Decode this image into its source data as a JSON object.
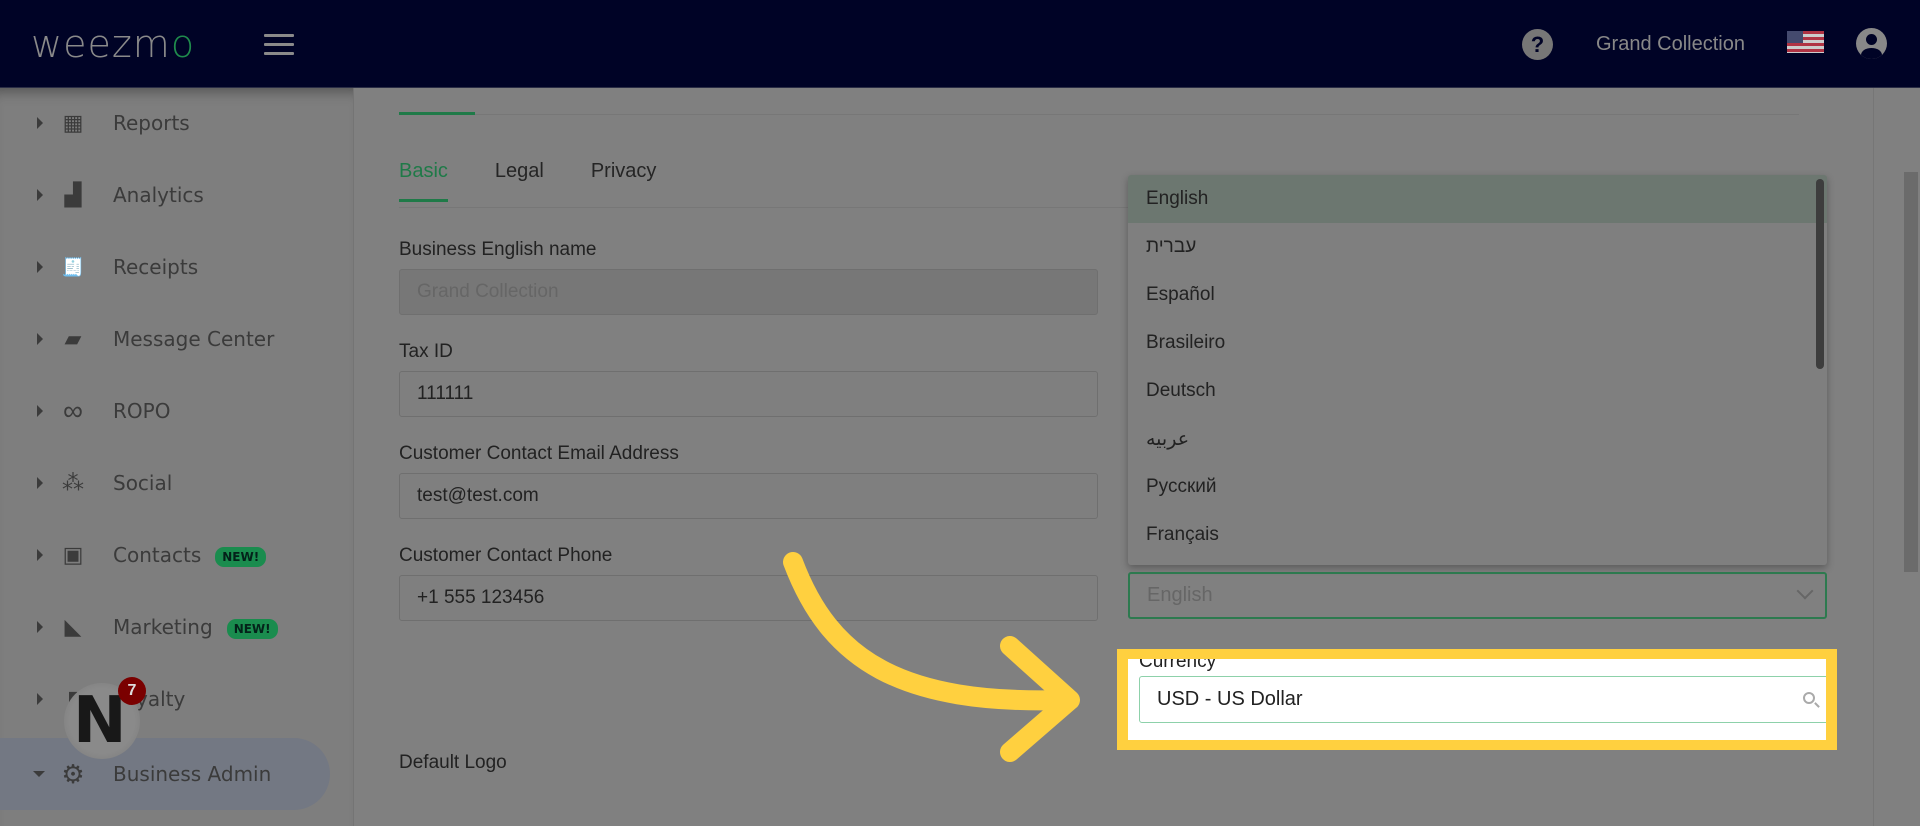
{
  "topbar": {
    "logo_text": "weezm",
    "logo_o": "o",
    "help_glyph": "?",
    "tenant_name": "Grand Collection"
  },
  "sidebar": {
    "items": [
      {
        "label": "Reports",
        "icon": "dashboard-icon",
        "glyph": "▦"
      },
      {
        "label": "Analytics",
        "icon": "bar-chart-icon",
        "glyph": "▟"
      },
      {
        "label": "Receipts",
        "icon": "receipt-icon",
        "glyph": "🧾"
      },
      {
        "label": "Message Center",
        "icon": "chat-bubble-icon",
        "glyph": "▰"
      },
      {
        "label": "ROPO",
        "icon": "infinity-icon",
        "glyph": "∞"
      },
      {
        "label": "Social",
        "icon": "people-group-icon",
        "glyph": "⁂"
      },
      {
        "label": "Contacts",
        "icon": "contact-card-icon",
        "glyph": "▣",
        "badge": "NEW!"
      },
      {
        "label": "Marketing",
        "icon": "party-popper-icon",
        "glyph": "◣",
        "badge": "NEW!"
      },
      {
        "label": "Loyalty",
        "icon": "loyalty-icon",
        "glyph": "▮"
      },
      {
        "label": "Business Admin",
        "icon": "gear-icon",
        "glyph": "⚙"
      }
    ]
  },
  "notification": {
    "letter": "N",
    "count": "7"
  },
  "main": {
    "tabs": [
      "Basic",
      "Legal",
      "Privacy"
    ],
    "fields": [
      {
        "label": "Business English name",
        "value": "Grand Collection",
        "disabled": true
      },
      {
        "label": "Tax ID",
        "value": "111111"
      },
      {
        "label": "Customer Contact Email Address",
        "value": "test@test.com"
      },
      {
        "label": "Customer Contact Phone",
        "value": "+1 555 123456"
      }
    ],
    "language_dropdown": {
      "options": [
        "English",
        "עברית",
        "Español",
        "Brasileiro",
        "Deutsch",
        "عربيه",
        "Русский",
        "Français"
      ],
      "selected": "English"
    },
    "currency": {
      "label": "Currency",
      "value": "USD - US Dollar"
    },
    "default_logo_label": "Default Logo"
  },
  "colors": {
    "highlight": "#ffd03f",
    "accent_green": "#1f7a48",
    "topbar": "#000326"
  }
}
